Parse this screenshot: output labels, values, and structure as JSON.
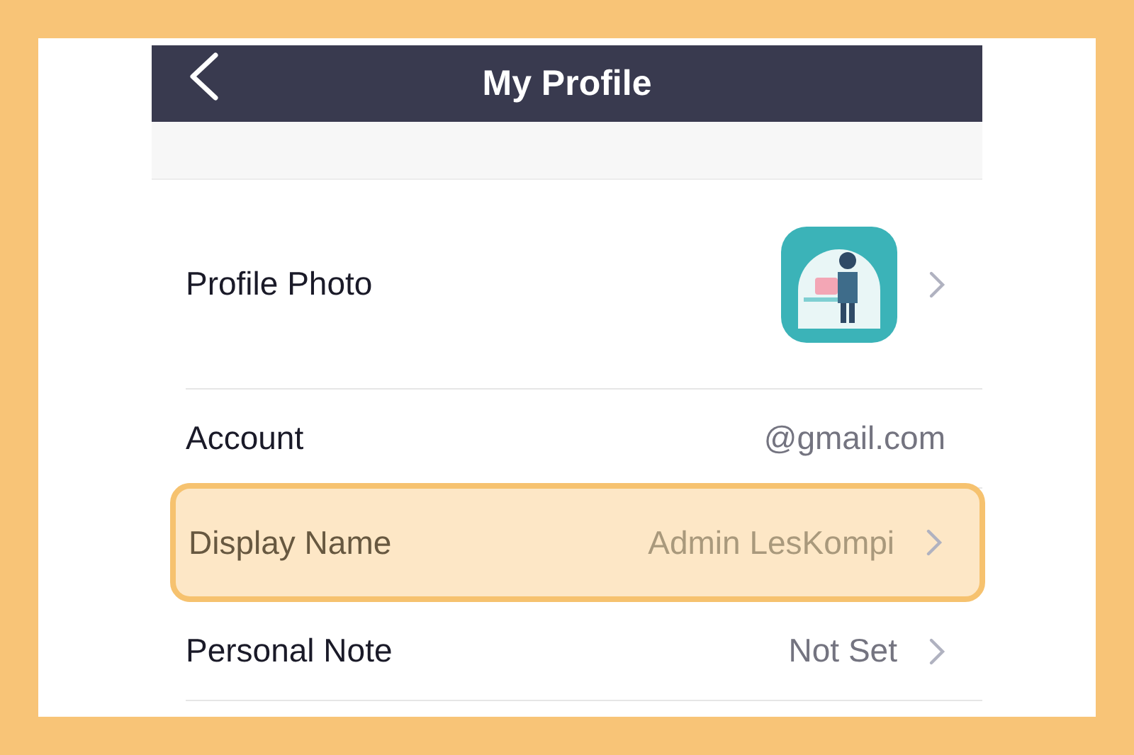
{
  "header": {
    "title": "My Profile"
  },
  "rows": [
    {
      "kind": "photo",
      "label": "Profile Photo",
      "chevron": true,
      "highlighted": false
    },
    {
      "kind": "value",
      "label": "Account",
      "value": "@gmail.com",
      "chevron": false,
      "highlighted": false
    },
    {
      "kind": "value",
      "label": "Display Name",
      "value": "Admin LesKompi",
      "chevron": true,
      "highlighted": true
    },
    {
      "kind": "value",
      "label": "Personal Note",
      "value": "Not Set",
      "chevron": true,
      "highlighted": false
    }
  ]
}
